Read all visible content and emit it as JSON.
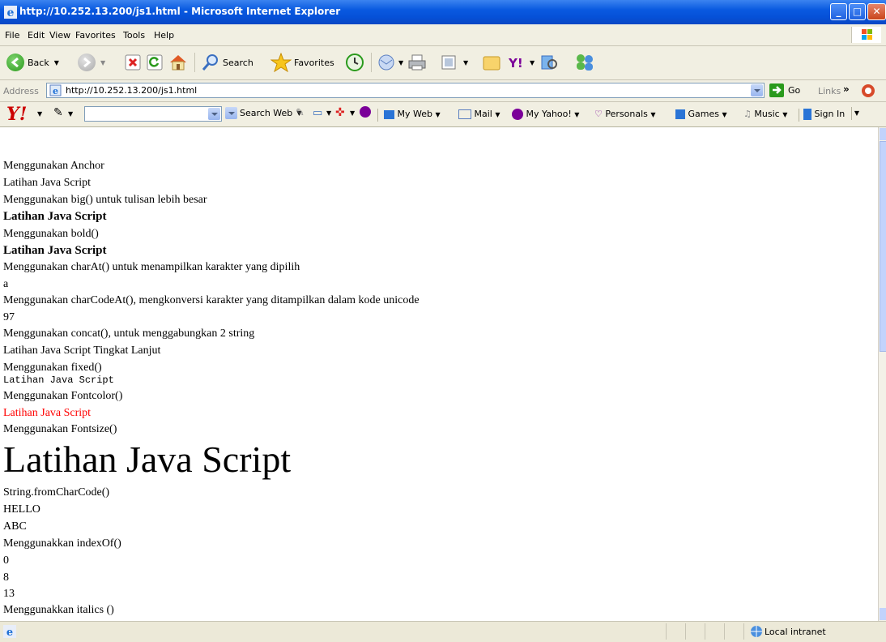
{
  "window": {
    "title": "http://10.252.13.200/js1.html - Microsoft Internet Explorer"
  },
  "menu": [
    "File",
    "Edit",
    "View",
    "Favorites",
    "Tools",
    "Help"
  ],
  "toolbar": {
    "back_label": "Back",
    "search_label": "Search",
    "favorites_label": "Favorites"
  },
  "address": {
    "label": "Address",
    "url": "http://10.252.13.200/js1.html",
    "go_label": "Go",
    "links_label": "Links",
    "links_chevron": "»"
  },
  "yahoo": {
    "search_web_label": "Search Web",
    "my_web_label": "My Web",
    "mail_label": "Mail",
    "my_yahoo_label": "My Yahoo!",
    "personals_label": "Personals",
    "games_label": "Games",
    "music_label": "Music",
    "sign_in_label": "Sign In"
  },
  "content": {
    "lines": [
      "Menggunakan Anchor",
      "Latihan Java Script",
      "Menggunakan big() untuk tulisan lebih besar",
      "Latihan Java Script",
      "Menggunakan bold()",
      "Latihan Java Script",
      "Menggunakan charAt() untuk menampilkan karakter yang dipilih",
      "a",
      "Menggunakan charCodeAt(), mengkonversi karakter yang ditampilkan dalam kode unicode",
      "97",
      "Menggunakan concat(), untuk menggabungkan 2 string",
      "Latihan Java Script Tingkat Lanjut",
      "Menggunakan fixed()",
      "Latihan Java Script",
      "Menggunakan Fontcolor()",
      "Latihan Java Script",
      "Menggunakan Fontsize()",
      "Latihan Java Script",
      "String.fromCharCode()",
      "HELLO",
      "ABC",
      "Menggunakkan indexOf()",
      "0",
      "8",
      "13",
      "Menggunakkan italics ()"
    ]
  },
  "status": {
    "zone_label": "Local intranet"
  },
  "colors": {
    "fontcolor_text": "#ff0000",
    "titlebar": "#0a5ae0"
  }
}
